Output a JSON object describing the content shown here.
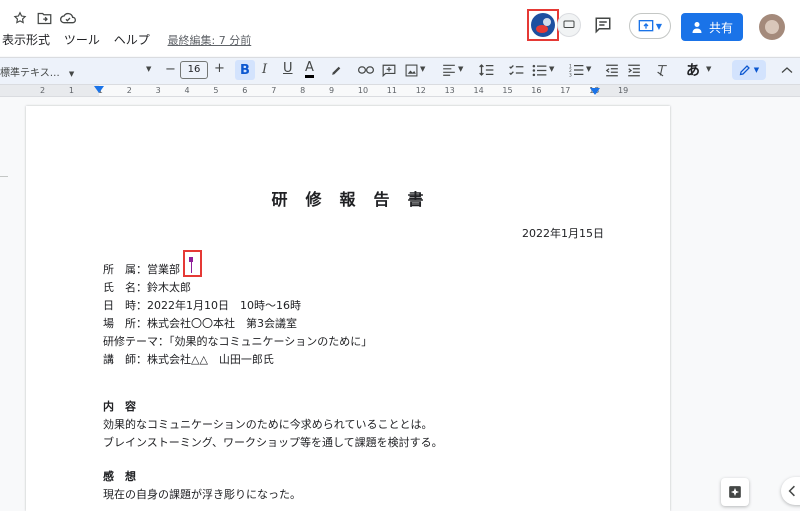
{
  "menu": {
    "view": "表示形式",
    "tools": "ツール",
    "help": "ヘルプ",
    "last_edit": "最終編集: 7 分前"
  },
  "header": {
    "share_label": "共有"
  },
  "toolbar": {
    "style_select": "標準テキス…",
    "font_size": "16",
    "input_tool": "あ"
  },
  "ruler": {
    "numbers": [
      "2",
      "1",
      "1",
      "2",
      "3",
      "4",
      "5",
      "6",
      "7",
      "8",
      "9",
      "10",
      "11",
      "12",
      "13",
      "14",
      "15",
      "16",
      "17",
      "18",
      "19"
    ]
  },
  "document": {
    "title": "研　修　報　告　書",
    "date": "2022年1月15日",
    "fields": [
      "所　属：営業部",
      "氏　名：鈴木太郎",
      "日　時：2022年1月10日　10時～16時",
      "場　所：株式会社〇〇本社　第3会議室",
      "研修テーマ：「効果的なコミュニケーションのために」",
      "講　師：株式会社△△　山田一郎氏"
    ],
    "section1_heading": "内　容",
    "section1_lines": [
      "効果的なコミュニケーションのために今求められていることとは。",
      "ブレインストーミング、ワークショップ等を通して課題を検討する。"
    ],
    "section2_heading": "感　想",
    "section2_lines": [
      "現在の自身の課題が浮き彫りになった。"
    ]
  },
  "colors": {
    "accent": "#1a73e8",
    "highlight_box": "#e53935"
  }
}
